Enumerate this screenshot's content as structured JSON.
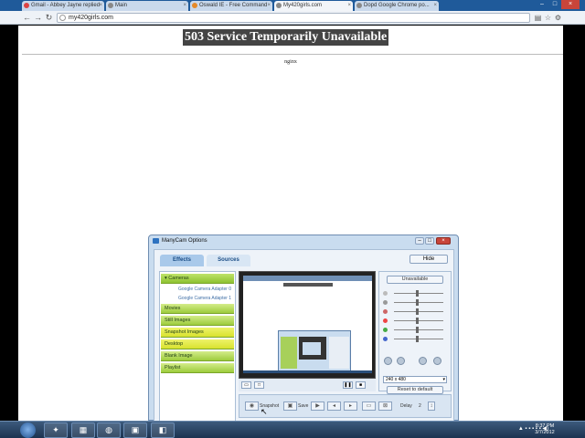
{
  "browser": {
    "tabs": [
      {
        "label": "Gmail - Abbey Jayne replied",
        "active": false
      },
      {
        "label": "Main",
        "active": false
      },
      {
        "label": "Oswald IE - Free Command",
        "active": false
      },
      {
        "label": "My420girls.com",
        "active": true
      },
      {
        "label": "Dopd Google Chrome po...",
        "active": false
      }
    ],
    "address": "my420girls.com",
    "window_controls": [
      "–",
      "□",
      "×"
    ]
  },
  "page": {
    "heading": "503 Service Temporarily Unavailable",
    "server": "nginx"
  },
  "manycam": {
    "title": "ManyCam Options",
    "tabs": [
      "Effects",
      "Sources"
    ],
    "hide_button": "Hide",
    "categories": [
      {
        "label": "▾ Cameras",
        "style": "sel"
      },
      {
        "label": "Movies",
        "style": "normal"
      },
      {
        "label": "Still Images",
        "style": "normal"
      },
      {
        "label": "Snapshot Images",
        "style": "yel"
      },
      {
        "label": "Desktop",
        "style": "yel"
      },
      {
        "label": "Blank Image",
        "style": "normal"
      },
      {
        "label": "Playlist",
        "style": "normal"
      }
    ],
    "camera_sources": [
      "Google Camera Adapter 0",
      "Google Camera Adapter 1"
    ],
    "unavailable_button": "Unavailable",
    "resolution": "240 x 480",
    "reset_button": "Reset to default",
    "bottom": {
      "snapshot_label": "Snapshot",
      "save_label": "Save",
      "delay_label": "Delay",
      "delay_value": "2"
    }
  },
  "taskbar": {
    "apps": [
      "explorer-icon",
      "folder-icon",
      "chrome-icon",
      "app-icon",
      "manycam-icon"
    ],
    "time": "8:37 PM",
    "date": "3/7/2012"
  },
  "colors": {
    "tabbar": "#1f5a9a",
    "heading_bg": "#444444",
    "category_green": "#9dcc3c",
    "category_yellow": "#d8e22e",
    "manycam_frame": "#c9dcef"
  }
}
